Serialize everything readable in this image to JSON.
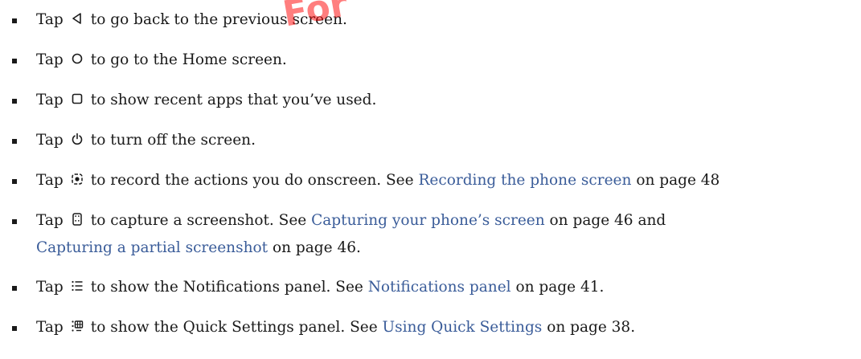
{
  "watermark": "For",
  "items": [
    {
      "tap": "Tap",
      "icon": "back-triangle-icon",
      "text": "to go back to the previous screen."
    },
    {
      "tap": "Tap",
      "icon": "home-circle-icon",
      "text": "to go to the Home screen."
    },
    {
      "tap": "Tap",
      "icon": "recent-apps-square-icon",
      "text": "to show recent apps that you’ve used."
    },
    {
      "tap": "Tap",
      "icon": "power-icon",
      "text": "to turn off the screen."
    },
    {
      "tap": "Tap",
      "icon": "screen-record-icon",
      "text": "to record the actions you do onscreen. See",
      "link1": "Recording the phone screen",
      "after1": "on page 48"
    },
    {
      "tap": "Tap",
      "icon": "screenshot-icon",
      "text": "to capture a screenshot. See",
      "link1": "Capturing your phone’s screen",
      "after1": "on page 46 and",
      "link2": "Capturing a partial screenshot",
      "after2": "on page 46."
    },
    {
      "tap": "Tap",
      "icon": "notifications-list-icon",
      "text": "to show the Notifications panel. See",
      "link1": "Notifications panel",
      "after1": "on page 41."
    },
    {
      "tap": "Tap",
      "icon": "quick-settings-icon",
      "text": "to show the Quick Settings panel. See",
      "link1": "Using Quick Settings",
      "after1": "on page 38."
    }
  ],
  "colors": {
    "text": "#1a1a1a",
    "link": "#3a5c99",
    "watermark": "#ff0000"
  }
}
